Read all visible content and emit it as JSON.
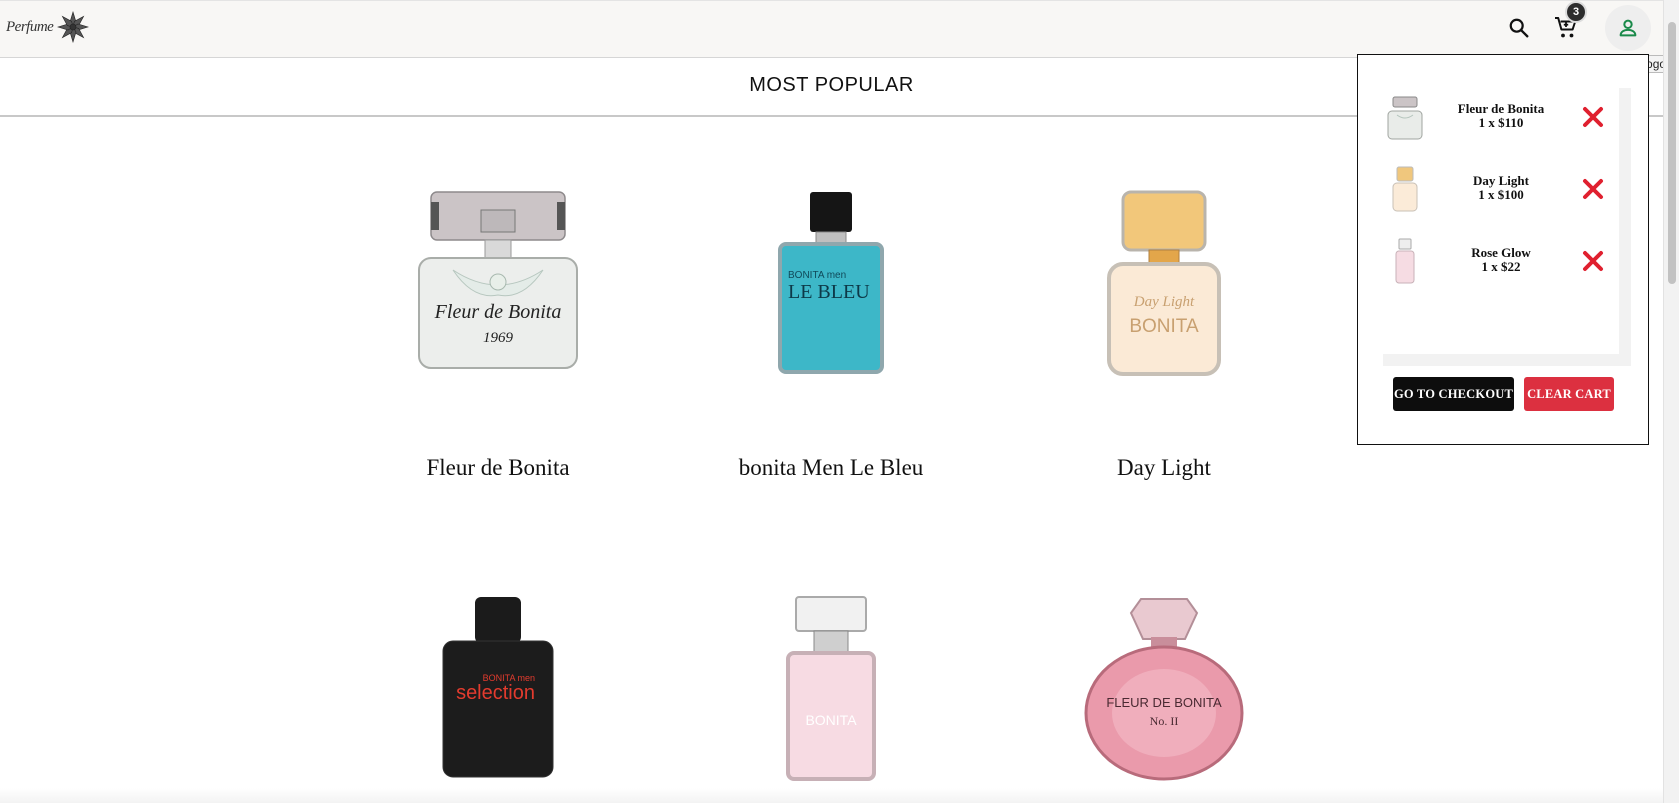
{
  "header": {
    "logo_text": "Perfume",
    "cart_count": "3",
    "user_tooltip": "Double click to logout",
    "accent_user": "#1a8a4a"
  },
  "section": {
    "title": "MOST POPULAR"
  },
  "products": [
    {
      "name": "Fleur de Bonita",
      "label": "Fleur de Bonita",
      "sublabel": "1969"
    },
    {
      "name": "bonita Men Le Bleu",
      "label": "LE BLEU",
      "sublabel": "BONITA men"
    },
    {
      "name": "Day Light",
      "label": "BONITA",
      "sublabel": "Day Light"
    },
    {
      "name": "",
      "label": "selection",
      "sublabel": "BONITA men"
    },
    {
      "name": "",
      "label": "BONITA",
      "sublabel": ""
    },
    {
      "name": "",
      "label": "FLEUR DE BONITA",
      "sublabel": "No. II"
    }
  ],
  "cart": {
    "items": [
      {
        "name": "Fleur de Bonita",
        "qty_price": "1 x $110"
      },
      {
        "name": "Day Light",
        "qty_price": "1 x $100"
      },
      {
        "name": "Rose Glow",
        "qty_price": "1 x $22"
      }
    ],
    "checkout_label": "GO TO CHECKOUT",
    "clear_label": "CLEAR CART",
    "remove_color": "#e0202f"
  }
}
